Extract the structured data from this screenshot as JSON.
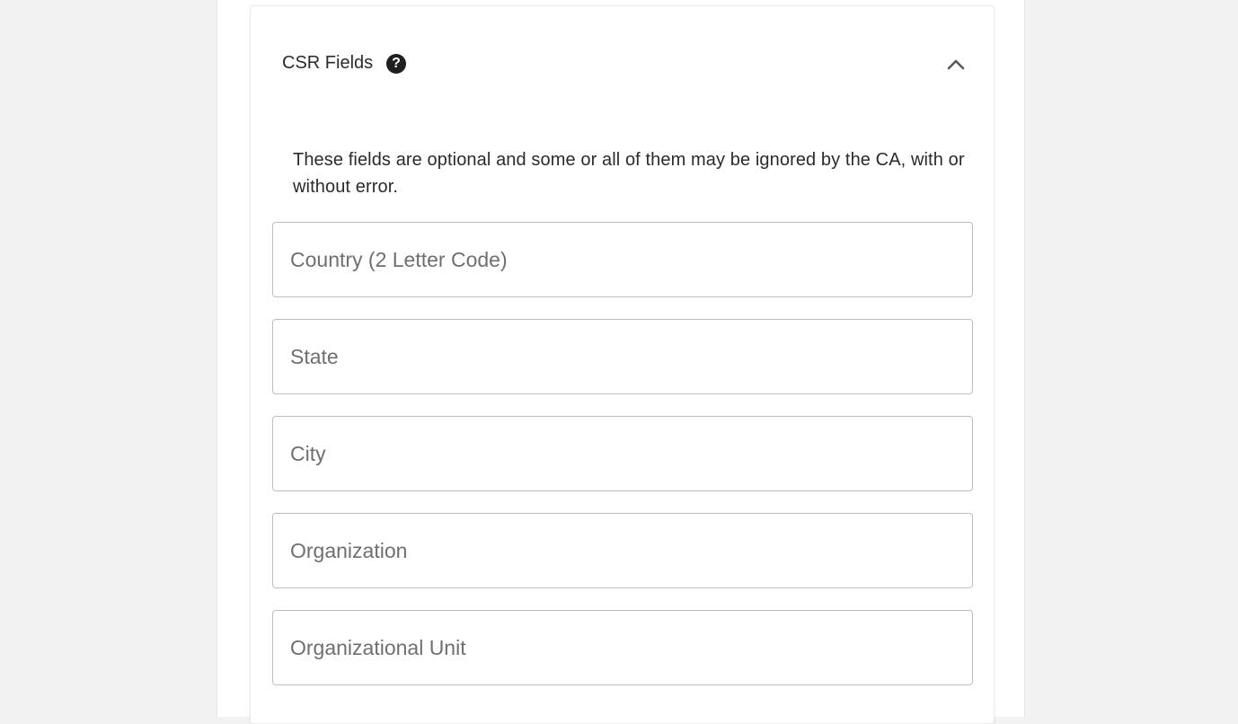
{
  "csr_card": {
    "title": "CSR Fields",
    "help_icon": "question-circle-icon",
    "help_symbol": "?",
    "collapse_icon": "chevron-up-icon",
    "description": "These fields are optional and some or all of them may be ignored by the CA, with or without error.",
    "fields": [
      {
        "placeholder": "Country (2 Letter Code)",
        "value": ""
      },
      {
        "placeholder": "State",
        "value": ""
      },
      {
        "placeholder": "City",
        "value": ""
      },
      {
        "placeholder": "Organization",
        "value": ""
      },
      {
        "placeholder": "Organizational Unit",
        "value": ""
      }
    ]
  },
  "colors": {
    "page_background": "#f2f2f2",
    "card_background": "#ffffff",
    "field_border": "#bdbdbd",
    "text": "#2b2b2b",
    "placeholder": "#6f6f6f"
  }
}
